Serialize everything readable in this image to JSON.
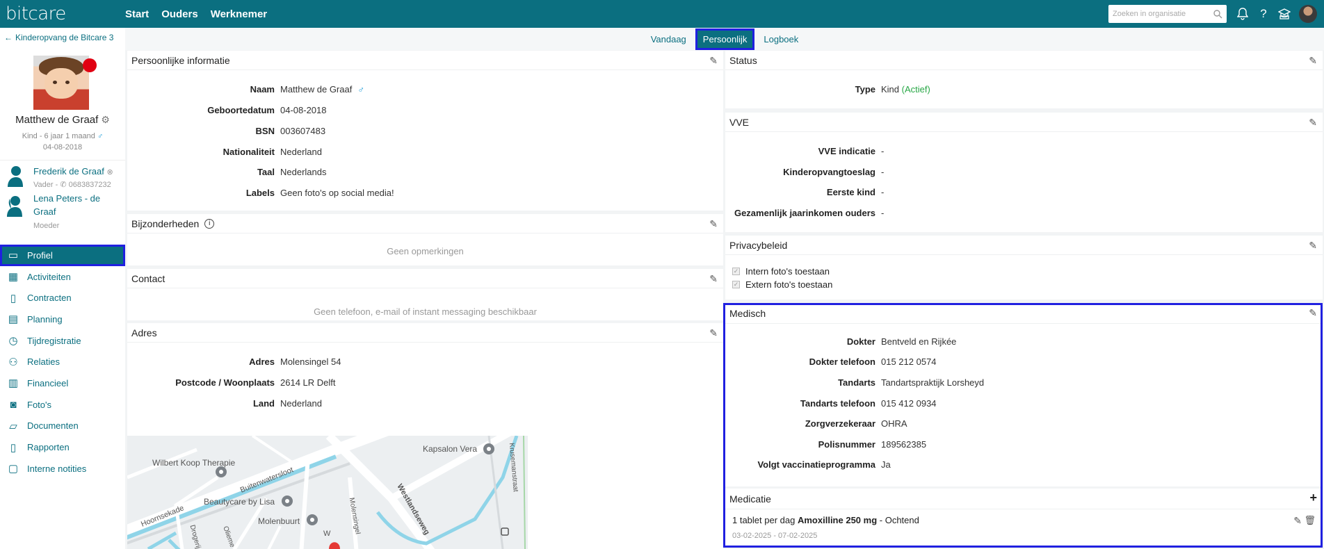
{
  "app": {
    "logo": "bitcare",
    "nav": [
      "Start",
      "Ouders",
      "Werknemer"
    ],
    "search_placeholder": "Zoeken in organisatie"
  },
  "sidebar": {
    "back_label": "Kinderopvang de Bitcare 3",
    "child_name": "Matthew de Graaf",
    "child_info": "Kind - 6 jaar 1 maand",
    "child_dob": "04-08-2018",
    "relations": [
      {
        "name": "Frederik de Graaf",
        "role": "Vader - ",
        "phone": "0683837232"
      },
      {
        "name_line1": "Lena Peters - de",
        "name_line2": "Graaf",
        "role": "Moeder"
      }
    ],
    "menu": [
      "Profiel",
      "Activiteiten",
      "Contracten",
      "Planning",
      "Tijdregistratie",
      "Relaties",
      "Financieel",
      "Foto's",
      "Documenten",
      "Rapporten",
      "Interne notities"
    ]
  },
  "tabs": [
    "Vandaag",
    "Persoonlijk",
    "Logboek"
  ],
  "personal": {
    "title": "Persoonlijke informatie",
    "rows": [
      {
        "k": "Naam",
        "v": "Matthew de Graaf"
      },
      {
        "k": "Geboortedatum",
        "v": "04-08-2018"
      },
      {
        "k": "BSN",
        "v": "003607483"
      },
      {
        "k": "Nationaliteit",
        "v": "Nederland"
      },
      {
        "k": "Taal",
        "v": "Nederlands"
      },
      {
        "k": "Labels",
        "v": "Geen foto's op social media!"
      }
    ]
  },
  "special": {
    "title": "Bijzonderheden",
    "empty": "Geen opmerkingen"
  },
  "contact": {
    "title": "Contact",
    "empty": "Geen telefoon, e-mail of instant messaging beschikbaar"
  },
  "address": {
    "title": "Adres",
    "rows": [
      {
        "k": "Adres",
        "v": "Molensingel 54"
      },
      {
        "k": "Postcode / Woonplaats",
        "v": "2614 LR Delft"
      },
      {
        "k": "Land",
        "v": "Nederland"
      }
    ]
  },
  "map": {
    "pois": [
      "Wilbert Koop Therapie",
      "Kapsalon Vera",
      "Beautycare by Lisa",
      "Molenbuurt"
    ],
    "streets": [
      "Buitenwatersloot",
      "Hoornsekade",
      "Westlandseweg",
      "Molensingel",
      "Drogerij",
      "Olieme",
      "Krusemanstraat",
      "W"
    ]
  },
  "status": {
    "title": "Status",
    "type_label": "Type",
    "type_value": "Kind",
    "type_state": "(Actief)"
  },
  "vve": {
    "title": "VVE",
    "rows": [
      {
        "k": "VVE indicatie",
        "v": "-"
      },
      {
        "k": "Kinderopvangtoeslag",
        "v": "-"
      },
      {
        "k": "Eerste kind",
        "v": "-"
      },
      {
        "k": "Gezamenlijk jaarinkomen ouders",
        "v": "-"
      }
    ]
  },
  "privacy": {
    "title": "Privacybeleid",
    "items": [
      "Intern foto's toestaan",
      "Extern foto's toestaan"
    ]
  },
  "medical": {
    "title": "Medisch",
    "rows": [
      {
        "k": "Dokter",
        "v": "Bentveld en Rijkée"
      },
      {
        "k": "Dokter telefoon",
        "v": "015 212 0574"
      },
      {
        "k": "Tandarts",
        "v": "Tandartspraktijk Lorsheyd"
      },
      {
        "k": "Tandarts telefoon",
        "v": "015 412 0934"
      },
      {
        "k": "Zorgverzekeraar",
        "v": "OHRA"
      },
      {
        "k": "Polisnummer",
        "v": "189562385"
      },
      {
        "k": "Volgt vaccinatieprogramma",
        "v": "Ja"
      }
    ]
  },
  "medication": {
    "title": "Medicatie",
    "dose": "1 tablet per dag",
    "drug": "Amoxilline 250 mg",
    "sep": " - ",
    "time": "Ochtend",
    "period": "03-02-2025 - 07-02-2025"
  }
}
